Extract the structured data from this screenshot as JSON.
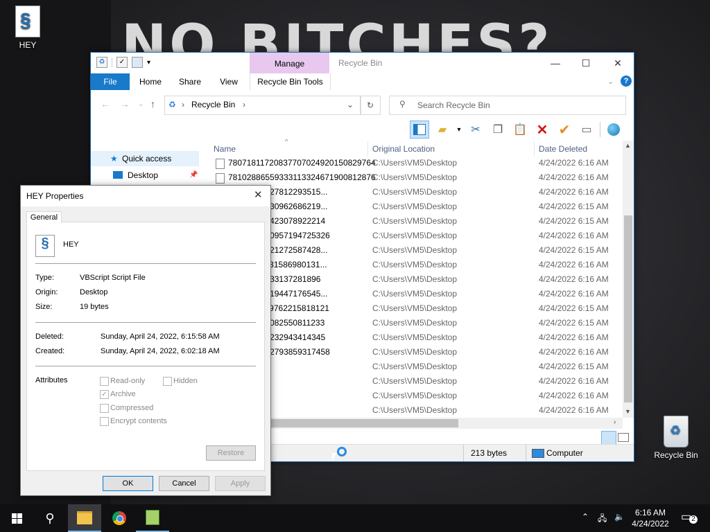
{
  "desktop": {
    "wallpaper_text": "NO BITCHES?",
    "icon_hey_label": "HEY",
    "icon_recycle_label": "Recycle Bin"
  },
  "explorer": {
    "window_title": "Recycle Bin",
    "manage_label": "Manage",
    "tabs": [
      "File",
      "Home",
      "Share",
      "View",
      "Recycle Bin Tools"
    ],
    "address": "Recycle Bin",
    "search_placeholder": "Search Recycle Bin",
    "nav": {
      "quick_access": "Quick access",
      "desktop": "Desktop"
    },
    "columns": {
      "name": "Name",
      "location": "Original Location",
      "date": "Date Deleted"
    },
    "rows": [
      {
        "name": "780718117208377070249201508297​64",
        "location": "C:\\Users\\VM5\\Desktop",
        "date": "4/24/2022 6:16 AM"
      },
      {
        "name": "781028865593331133246719008128​76",
        "location": "C:\\Users\\VM5\\Desktop",
        "date": "4/24/2022 6:16 AM"
      },
      {
        "name": "797224291278122935​15...",
        "location": "C:\\Users\\VM5\\Desktop",
        "date": "4/24/2022 6:16 AM"
      },
      {
        "name": "893137242309626862​19...",
        "location": "C:\\Users\\VM5\\Desktop",
        "date": "4/24/2022 6:15 AM"
      },
      {
        "name": "675850196423078922214",
        "location": "C:\\Users\\VM5\\Desktop",
        "date": "4/24/2022 6:15 AM"
      },
      {
        "name": "354290821095719472​5326",
        "location": "C:\\Users\\VM5\\Desktop",
        "date": "4/24/2022 6:16 AM"
      },
      {
        "name": "971820378212725874​28...",
        "location": "C:\\Users\\VM5\\Desktop",
        "date": "4/24/2022 6:15 AM"
      },
      {
        "name": "481411673315869801​31...",
        "location": "C:\\Users\\VM5\\Desktop",
        "date": "4/24/2022 6:16 AM"
      },
      {
        "name": "678296891331372818​96",
        "location": "C:\\Users\\VM5\\Desktop",
        "date": "4/24/2022 6:16 AM"
      },
      {
        "name": "777427032194471765​45...",
        "location": "C:\\Users\\VM5\\Desktop",
        "date": "4/24/2022 6:16 AM"
      },
      {
        "name": "371183272976221581​8121",
        "location": "C:\\Users\\VM5\\Desktop",
        "date": "4/24/2022 6:15 AM"
      },
      {
        "name": "735962273082550811233",
        "location": "C:\\Users\\VM5\\Desktop",
        "date": "4/24/2022 6:15 AM"
      },
      {
        "name": "331918176232943414345",
        "location": "C:\\Users\\VM5\\Desktop",
        "date": "4/24/2022 6:16 AM"
      },
      {
        "name": "369524981279385931​7458",
        "location": "C:\\Users\\VM5\\Desktop",
        "date": "4/24/2022 6:16 AM"
      },
      {
        "name": "",
        "location": "C:\\Users\\VM5\\Desktop",
        "date": "4/24/2022 6:15 AM"
      },
      {
        "name": "",
        "location": "C:\\Users\\VM5\\Desktop",
        "date": "4/24/2022 6:16 AM"
      },
      {
        "name": "",
        "location": "C:\\Users\\VM5\\Desktop",
        "date": "4/24/2022 6:16 AM"
      },
      {
        "name": "",
        "location": "C:\\Users\\VM5\\Desktop",
        "date": "4/24/2022 6:16 AM"
      }
    ],
    "status": {
      "size": "213 bytes",
      "zone": "Computer"
    }
  },
  "props": {
    "title": "HEY Properties",
    "tab": "General",
    "file_name": "HEY",
    "type_label": "Type:",
    "type_value": "VBScript Script File",
    "origin_label": "Origin:",
    "origin_value": "Desktop",
    "size_label": "Size:",
    "size_value": "19 bytes",
    "deleted_label": "Deleted:",
    "deleted_value": "Sunday, April 24, 2022, 6:15:58 AM",
    "created_label": "Created:",
    "created_value": "Sunday, April 24, 2022, 6:02:18 AM",
    "attributes_label": "Attributes",
    "attr": {
      "readonly": "Read-only",
      "hidden": "Hidden",
      "archive": "Archive",
      "compressed": "Compressed",
      "encrypt": "Encrypt contents"
    },
    "restore": "Restore",
    "ok": "OK",
    "cancel": "Cancel",
    "apply": "Apply"
  },
  "taskbar": {
    "time": "6:16 AM",
    "date": "4/24/2022",
    "notif_count": "2"
  }
}
